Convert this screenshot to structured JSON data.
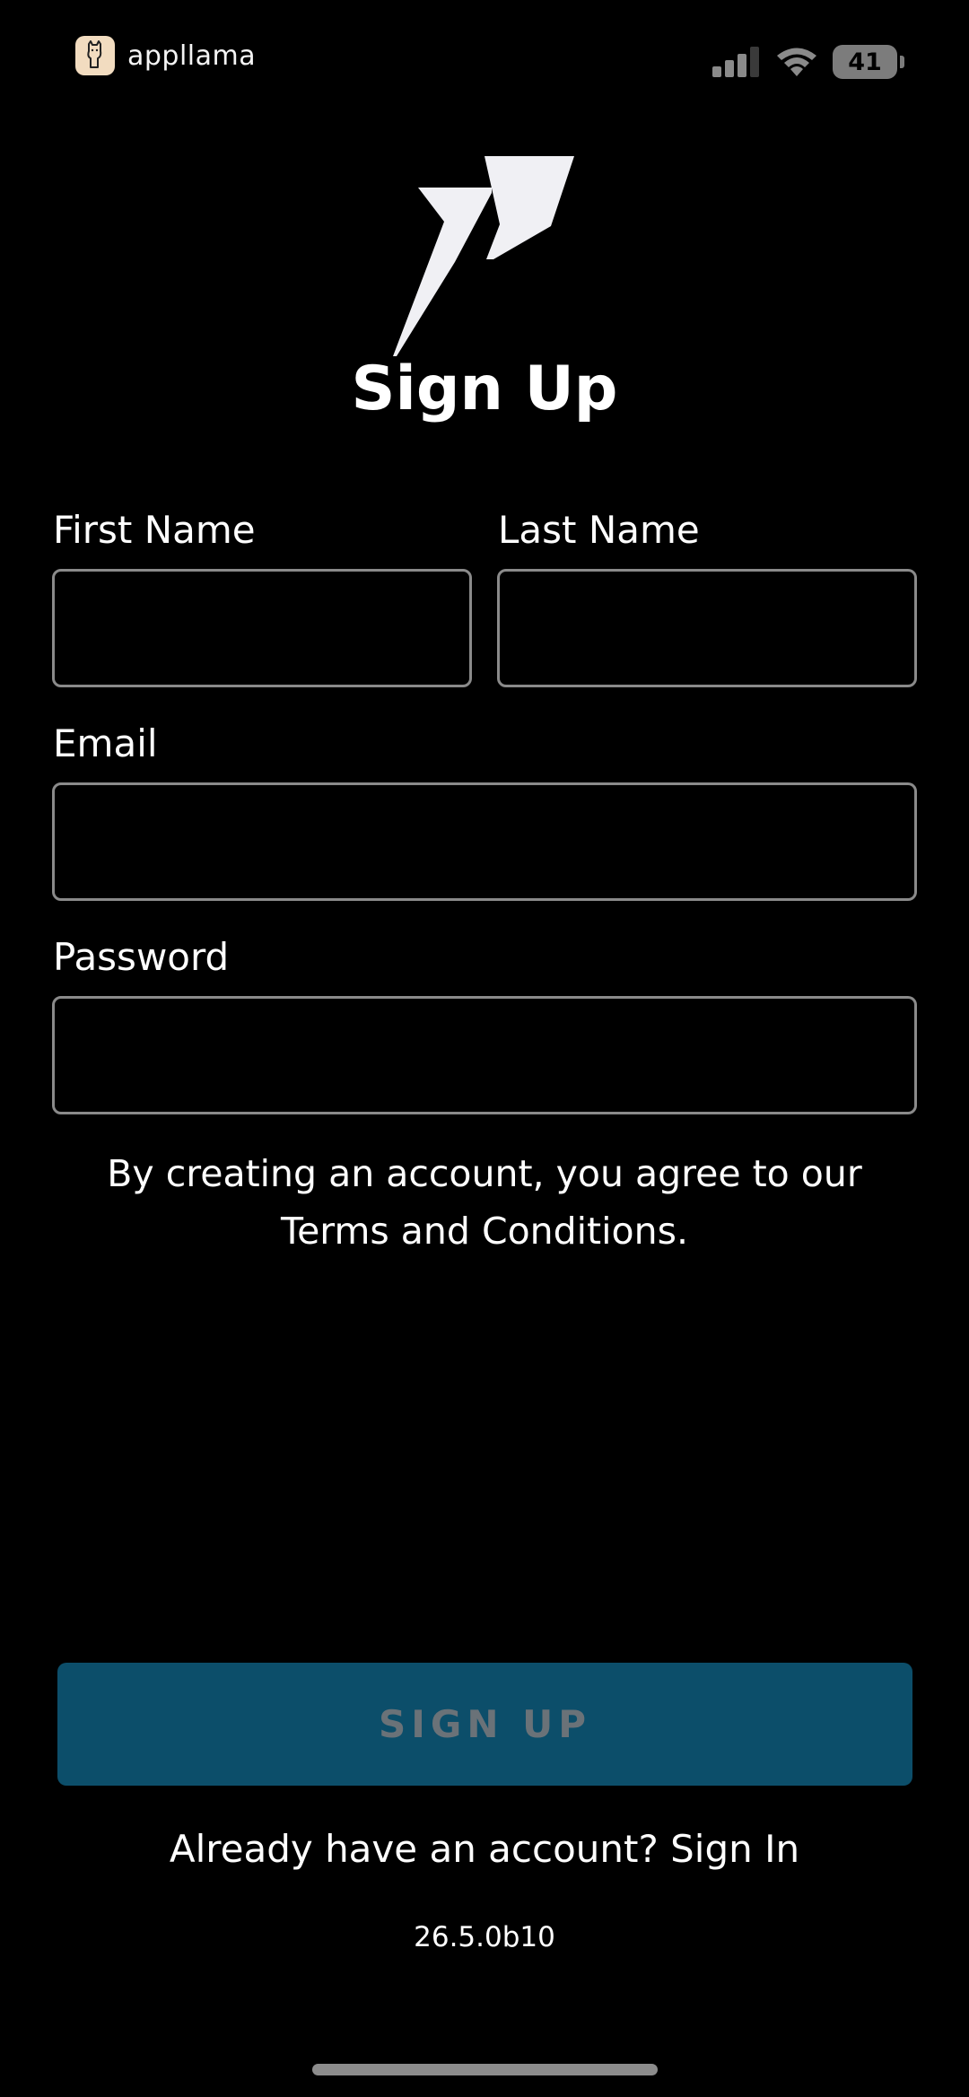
{
  "status_bar": {
    "app_name": "appllama",
    "battery_level": "41"
  },
  "signup": {
    "title": "Sign Up",
    "first_name_label": "First Name",
    "last_name_label": "Last Name",
    "email_label": "Email",
    "password_label": "Password",
    "first_name_value": "",
    "last_name_value": "",
    "email_value": "",
    "password_value": "",
    "terms_line1": "By creating an account, you agree to our",
    "terms_line2": "Terms and Conditions.",
    "button_label": "SIGN UP",
    "signin_text": "Already have an account? Sign In",
    "version": "26.5.0b10"
  },
  "colors": {
    "background": "#000000",
    "primary_button": "#0c4e6a",
    "input_border": "#8a8a8a",
    "text": "#ffffff"
  }
}
